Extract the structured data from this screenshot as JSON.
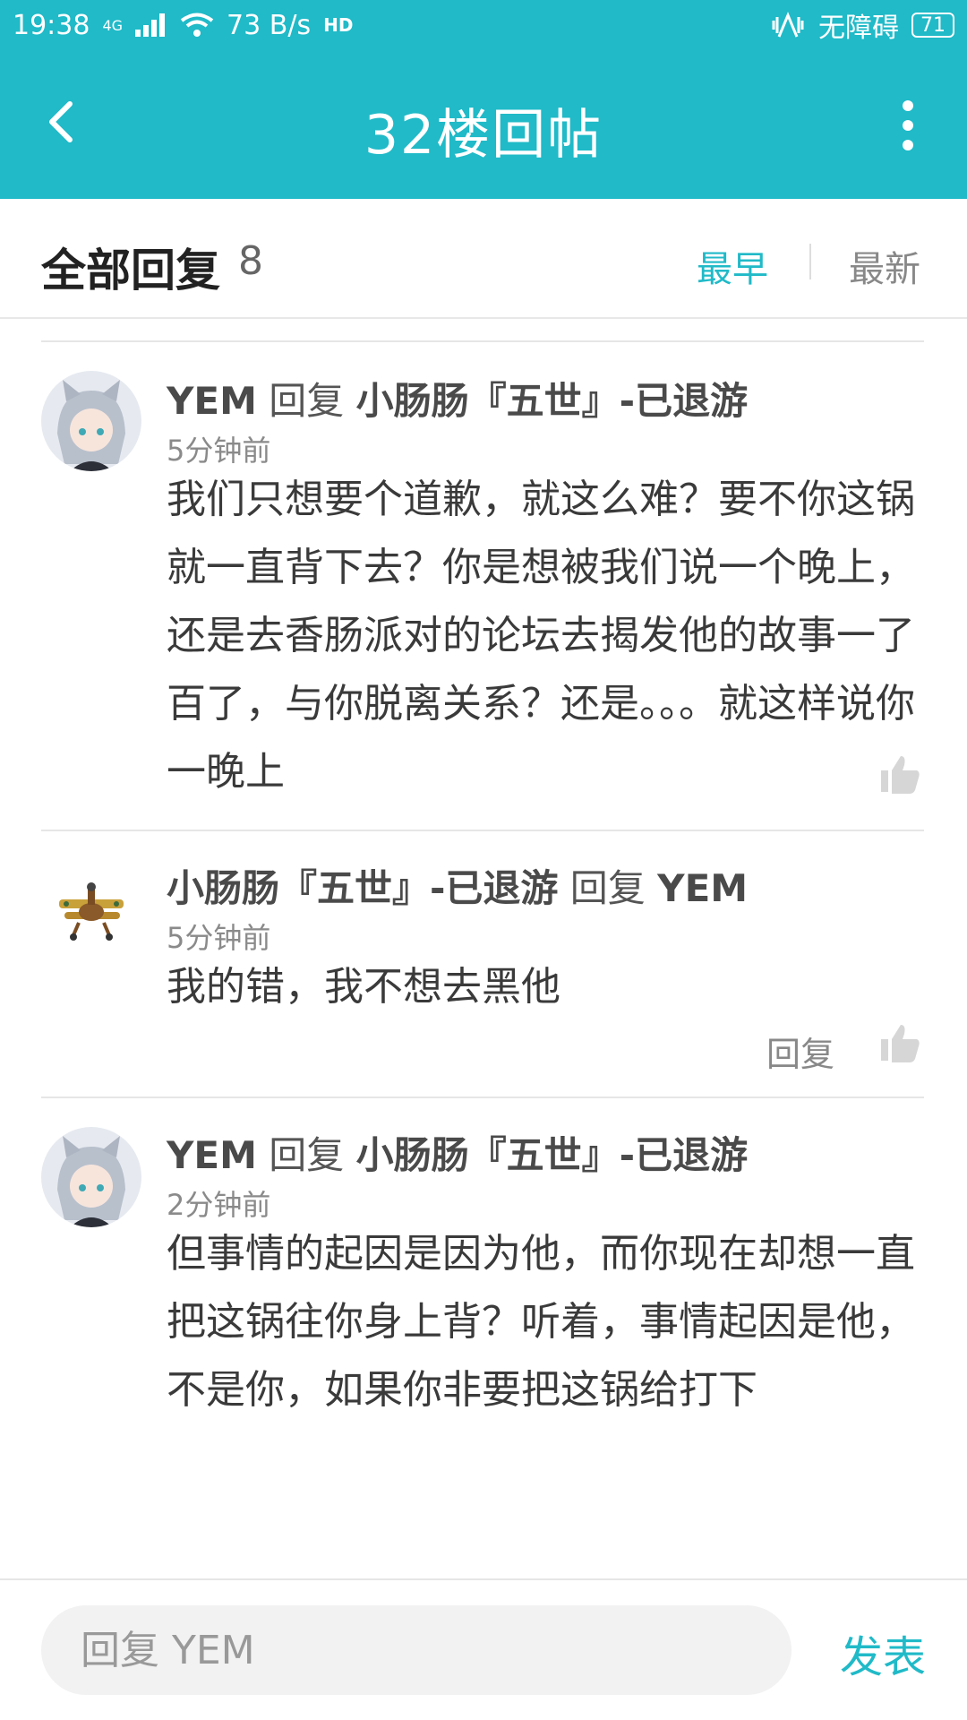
{
  "status": {
    "time": "19:38",
    "net": "4G",
    "speed": "73 B/s",
    "accessibility": "无障碍",
    "battery": "71"
  },
  "appbar": {
    "title": "32楼回帖"
  },
  "listhead": {
    "title": "全部回复",
    "count": "8",
    "sort_earliest": "最早",
    "sort_latest": "最新"
  },
  "comments": [
    {
      "user": "YEM",
      "reply_word": "回复",
      "to": "小肠肠『五世』-已退游",
      "time": "5分钟前",
      "text": "我们只想要个道歉，就这么难？要不你这锅就一直背下去？你是想被我们说一个晚上，还是去香肠派对的论坛去揭发他的故事一了百了，与你脱离关系？还是。。。就这样说你一晚上"
    },
    {
      "user": "小肠肠『五世』-已退游",
      "reply_word": "回复",
      "to": "YEM",
      "time": "5分钟前",
      "text": "我的错，我不想去黑他",
      "reply_button": "回复"
    },
    {
      "user": "YEM",
      "reply_word": "回复",
      "to": "小肠肠『五世』-已退游",
      "time": "2分钟前",
      "text": "但事情的起因是因为他，而你现在却想一直把这锅往你身上背？听着，事情起因是他，不是你，如果你非要把这锅给打下"
    }
  ],
  "composer": {
    "placeholder": "回复 YEM",
    "send": "发表"
  },
  "colors": {
    "accent": "#20bac8"
  }
}
